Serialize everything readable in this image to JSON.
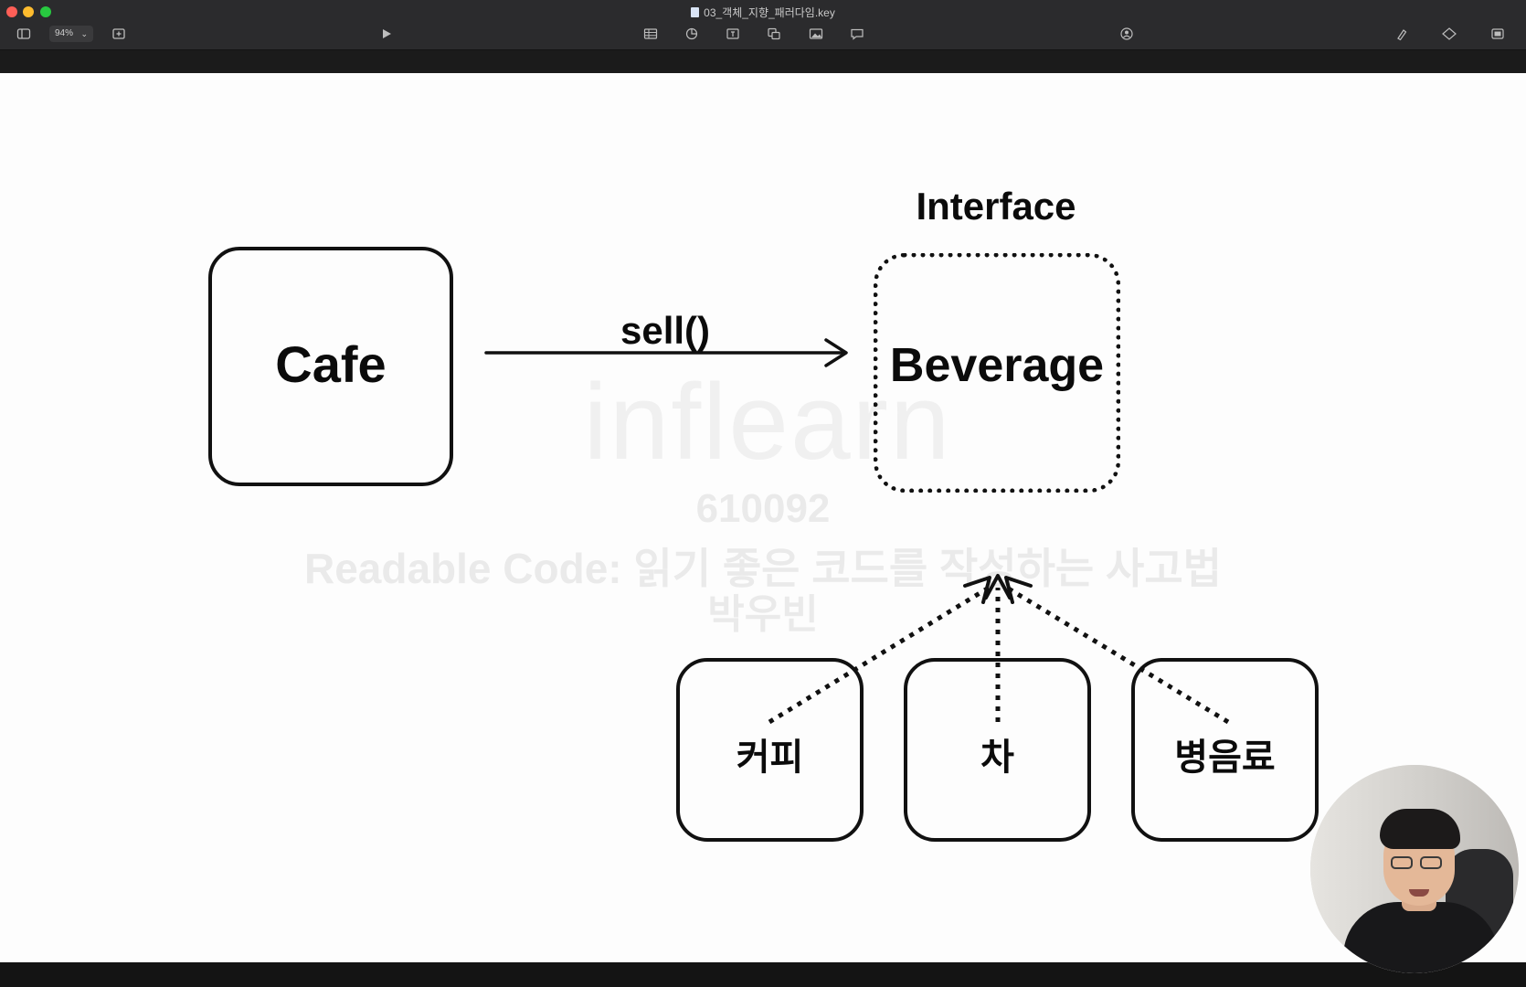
{
  "window": {
    "title": "03_객체_지향_패러다임.key",
    "zoom_label": "94%"
  },
  "toolbar": {
    "icons": [
      "sidebar-icon",
      "add-slide-icon",
      "play-icon",
      "table-icon",
      "chart-icon",
      "text-icon",
      "shape-icon",
      "media-icon",
      "comment-icon",
      "collaborate-icon",
      "format-icon",
      "animate-icon",
      "document-icon"
    ]
  },
  "slide": {
    "cafe_label": "Cafe",
    "method_label": "sell()",
    "interface_label": "Interface",
    "beverage_label": "Beverage",
    "children": [
      {
        "label": "커피"
      },
      {
        "label": "차"
      },
      {
        "label": "병음료"
      }
    ]
  },
  "watermark": {
    "brand": "inflearn",
    "code": "610092",
    "course": "Readable Code: 읽기 좋은 코드를 작성하는 사고법",
    "author": "박우빈"
  },
  "colors": {
    "ink": "#111111",
    "titlebar": "#2b2b2d",
    "slide_bg": "#fdfdfd"
  }
}
